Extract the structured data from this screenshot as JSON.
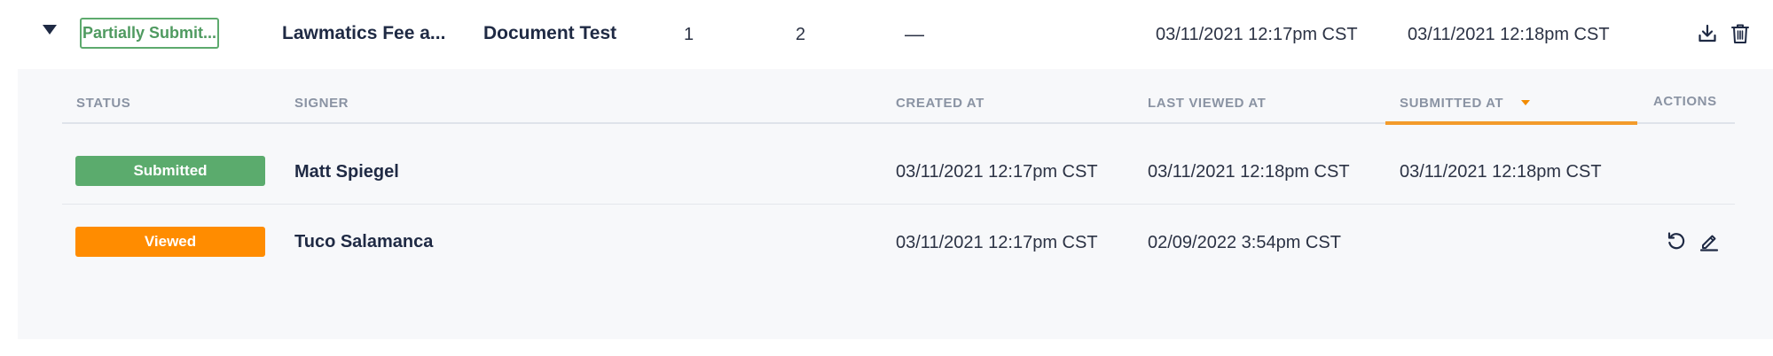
{
  "parent": {
    "status_label": "Partially Submit...",
    "title": "Lawmatics Fee a...",
    "document": "Document Test",
    "count_a": "1",
    "count_b": "2",
    "empty_value": "—",
    "created_at": "03/11/2021 12:17pm CST",
    "submitted_at": "03/11/2021 12:18pm CST",
    "actions": [
      "download-icon",
      "trash-icon"
    ],
    "colors": {
      "status_border": "#5daa6d"
    }
  },
  "subtable": {
    "headers": {
      "status": "STATUS",
      "signer": "SIGNER",
      "created_at": "CREATED AT",
      "last_viewed_at": "LAST VIEWED AT",
      "submitted_at": "SUBMITTED AT",
      "actions": "ACTIONS"
    },
    "sorted_by": "SUBMITTED AT",
    "rows": [
      {
        "status": "Submitted",
        "signer": "Matt Spiegel",
        "created_at": "03/11/2021 12:17pm CST",
        "last_viewed_at": "03/11/2021 12:18pm CST",
        "submitted_at": "03/11/2021 12:18pm CST",
        "actions": []
      },
      {
        "status": "Viewed",
        "signer": "Tuco Salamanca",
        "created_at": "03/11/2021 12:17pm CST",
        "last_viewed_at": "02/09/2022 3:54pm CST",
        "submitted_at": "",
        "actions": [
          "resend-icon",
          "edit-icon"
        ]
      }
    ]
  },
  "colors": {
    "accent": "#f39b2a",
    "submitted": "#5bab6d",
    "viewed": "#ff8c00"
  }
}
